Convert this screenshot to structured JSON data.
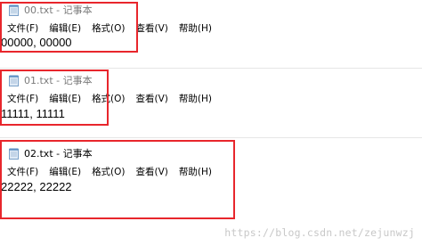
{
  "windows": [
    {
      "title": "00.txt - 记事本",
      "state": "inactive",
      "menu": [
        "文件(F)",
        "编辑(E)",
        "格式(O)",
        "查看(V)",
        "帮助(H)"
      ],
      "content": "00000, 00000"
    },
    {
      "title": "01.txt - 记事本",
      "state": "inactive",
      "menu": [
        "文件(F)",
        "编辑(E)",
        "格式(O)",
        "查看(V)",
        "帮助(H)"
      ],
      "content": "11111, 11111"
    },
    {
      "title": "02.txt - 记事本",
      "state": "active",
      "menu": [
        "文件(F)",
        "编辑(E)",
        "格式(O)",
        "查看(V)",
        "帮助(H)"
      ],
      "content": "22222, 22222"
    }
  ],
  "watermark": "https://blog.csdn.net/zejunwzj",
  "colors": {
    "highlight_frame": "#e8262c",
    "inactive_title": "#7a7a7a",
    "active_title": "#000000"
  },
  "icons": {
    "app": "notepad-icon"
  }
}
